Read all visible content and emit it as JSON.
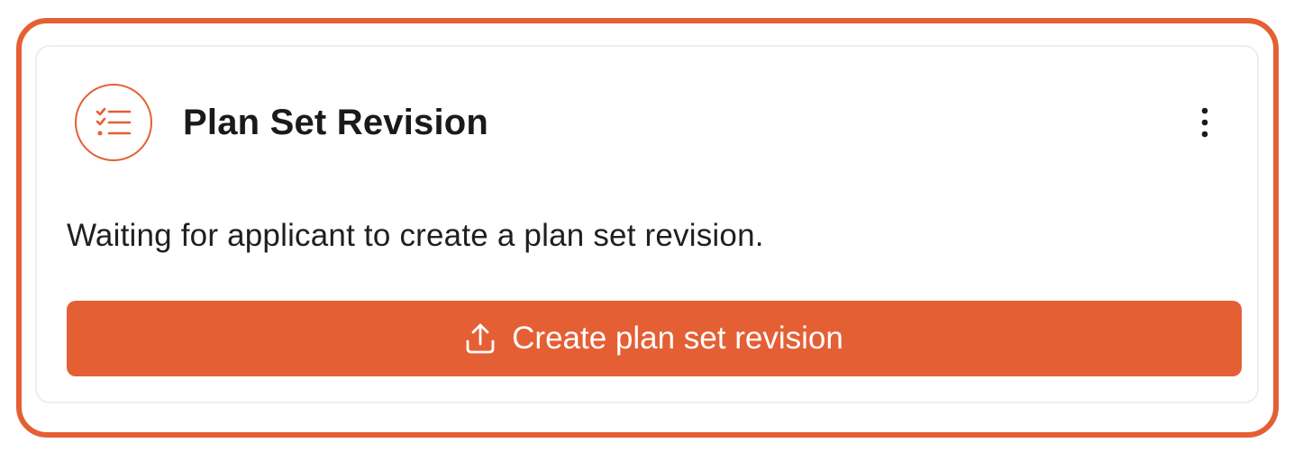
{
  "card": {
    "title": "Plan Set Revision",
    "header_icon": "checklist-icon",
    "menu_icon": "kebab-menu-icon",
    "description": "Waiting for applicant to create a plan set revision.",
    "action_button": {
      "label": "Create plan set revision",
      "icon": "upload-icon"
    }
  },
  "colors": {
    "accent": "#e55f34",
    "text": "#1a1a1a",
    "card_border": "#eeeeee"
  }
}
